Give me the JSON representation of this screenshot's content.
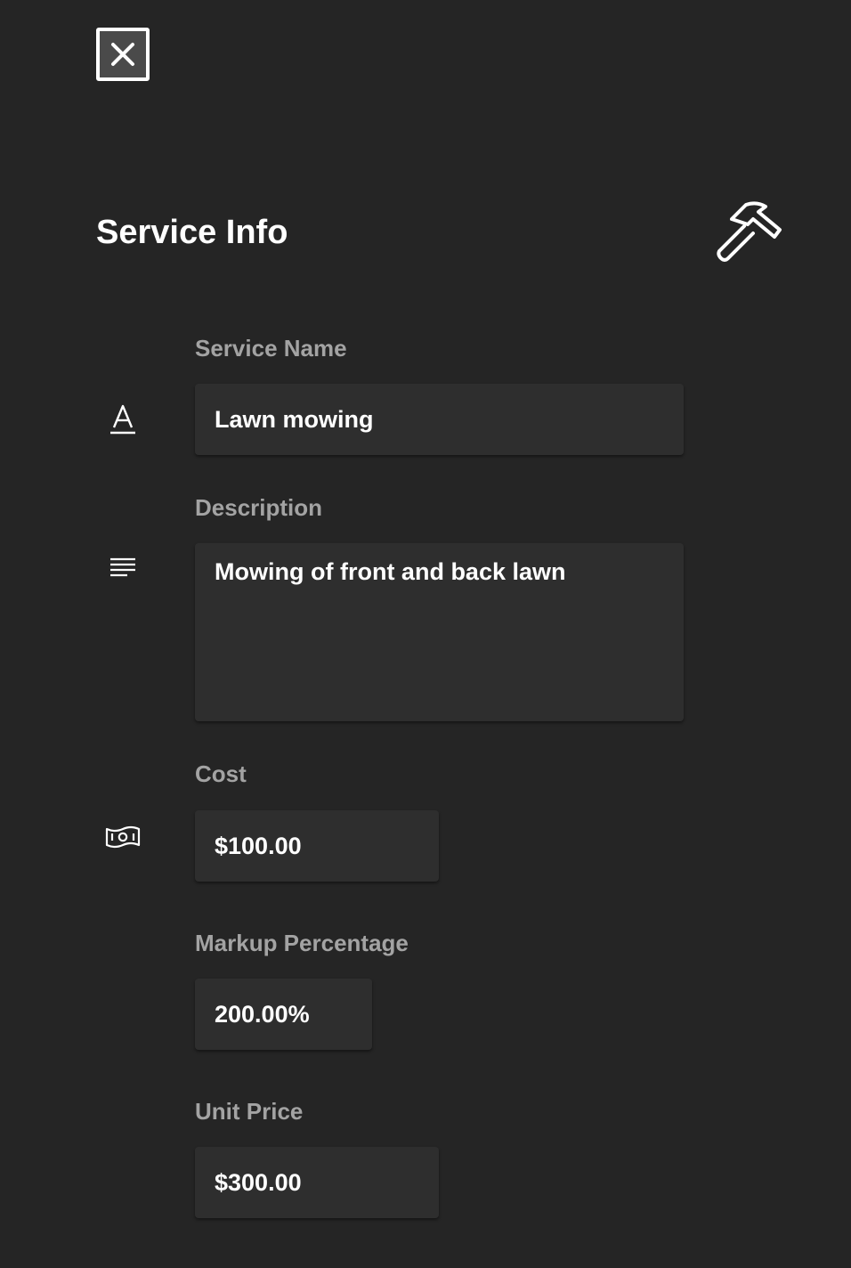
{
  "header": {
    "title": "Service Info",
    "close_icon": "close-icon",
    "badge_icon": "hammer-icon"
  },
  "form": {
    "service_name": {
      "label": "Service Name",
      "value": "Lawn mowing",
      "icon": "text-format-icon"
    },
    "description": {
      "label": "Description",
      "value": "Mowing of front and back lawn",
      "icon": "paragraph-icon"
    },
    "cost": {
      "label": "Cost",
      "value": "$100.00",
      "icon": "money-icon"
    },
    "markup": {
      "label": "Markup Percentage",
      "value": "200.00%"
    },
    "unit_price": {
      "label": "Unit Price",
      "value": "$300.00"
    }
  },
  "colors": {
    "background": "#252525",
    "field_background": "#2e2e2e",
    "label": "#a3a3a3",
    "text": "#ffffff"
  }
}
